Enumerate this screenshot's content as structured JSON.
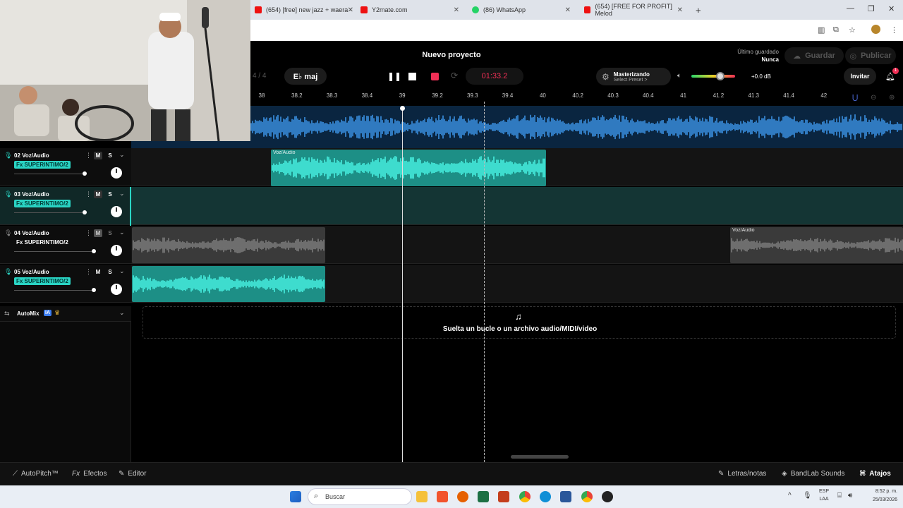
{
  "browser": {
    "tabs": [
      {
        "title": "(654) [free] new jazz + waera -",
        "icon_color": "#e11"
      },
      {
        "title": "Y2mate.com",
        "icon_color": "#e11"
      },
      {
        "title": "(86) WhatsApp",
        "icon_color": "#25d366"
      },
      {
        "title": "(654) [FREE FOR PROFIT] Melod",
        "icon_color": "#e11"
      }
    ],
    "new_tab": "+"
  },
  "app": {
    "project_title": "Nuevo proyecto",
    "last_saved_label": "Último guardado",
    "last_saved_value": "Nunca",
    "save_label": "Guardar",
    "publish_label": "Publicar",
    "time_signature": "4 / 4",
    "key": "E♭ maj",
    "time_display": "01:33.2",
    "mastering_label": "Masterizando",
    "preset_label": "Select Preset >",
    "volume_db": "+0.0 dB",
    "invite_label": "Invitar",
    "notification_count": "1",
    "accent_color": "#ef2f55",
    "clip_color": "#2ad4c4",
    "master_wave_color": "#3a8fe0"
  },
  "ruler": {
    "ticks": [
      "38",
      "38.2",
      "38.3",
      "38.4",
      "39",
      "39.2",
      "39.3",
      "39.4",
      "40",
      "40.2",
      "40.3",
      "40.4",
      "41",
      "41.2",
      "41.3",
      "41.4",
      "42"
    ]
  },
  "tracks": [
    {
      "number": "02",
      "name": "Voz/Audio",
      "fx": "Fx SUPERINTIMO/2",
      "fx_active": true,
      "muted": false,
      "volume": 0.8,
      "clip_label": "Voz/Audio"
    },
    {
      "number": "03",
      "name": "Voz/Audio",
      "fx": "Fx SUPERINTIMO/2",
      "fx_active": true,
      "muted": false,
      "volume": 0.8,
      "clip_label": ""
    },
    {
      "number": "04",
      "name": "Voz/Audio",
      "fx": "Fx SUPERINTIMO/2",
      "fx_active": false,
      "muted": true,
      "volume": 0.88,
      "clip_label": "Voz/Audio"
    },
    {
      "number": "05",
      "name": "Voz/Audio",
      "fx": "Fx SUPERINTIMO/2",
      "fx_active": true,
      "muted": false,
      "volume": 0.88,
      "clip_label": ""
    }
  ],
  "track_labels": {
    "mute": "M",
    "solo": "S",
    "menu": "⋮",
    "chevron": "⌄"
  },
  "automix": {
    "label": "AutoMix",
    "badge": "IA"
  },
  "drop_zone": {
    "text": "Suelta un bucle o un archivo audio/MIDI/video"
  },
  "bottom_bar": {
    "autopitch": "AutoPitch™",
    "effects": "Efectos",
    "editor": "Editor",
    "lyrics": "Letras/notas",
    "sounds": "BandLab Sounds",
    "shortcuts": "Atajos"
  },
  "taskbar": {
    "search_placeholder": "Buscar",
    "lang_top": "ESP",
    "lang_bottom": "LAA",
    "time": "8:52 p. m.",
    "date": "25/03/2026"
  }
}
